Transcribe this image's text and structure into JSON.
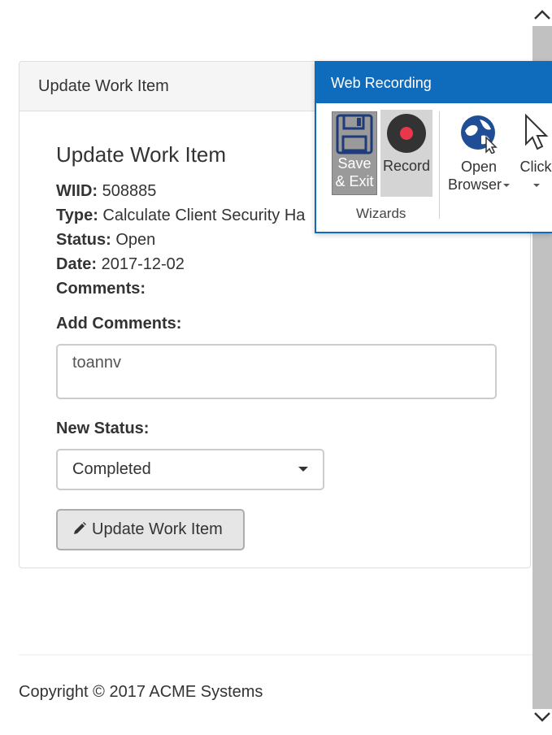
{
  "panel": {
    "heading": "Update Work Item",
    "title": "Update Work Item",
    "fields": {
      "wiid_label": "WIID:",
      "wiid_value": "508885",
      "type_label": "Type:",
      "type_value": "Calculate Client Security Ha",
      "status_label": "Status:",
      "status_value": "Open",
      "date_label": "Date:",
      "date_value": "2017-12-02",
      "comments_label": "Comments:"
    },
    "add_comments_label": "Add Comments:",
    "add_comments_value": "toannv",
    "new_status_label": "New Status:",
    "new_status_value": "Completed",
    "update_button": "Update Work Item"
  },
  "footer": {
    "copyright": "Copyright © 2017 ACME Systems"
  },
  "ribbon": {
    "title": "Web Recording",
    "save_exit_line1": "Save",
    "save_exit_line2": "& Exit",
    "record": "Record",
    "group": "Wizards",
    "open_browser_line1": "Open",
    "open_browser_line2": "Browser",
    "click": "Click"
  },
  "colors": {
    "ribbon_blue": "#0f6cbd",
    "record_red": "#e8374a"
  }
}
